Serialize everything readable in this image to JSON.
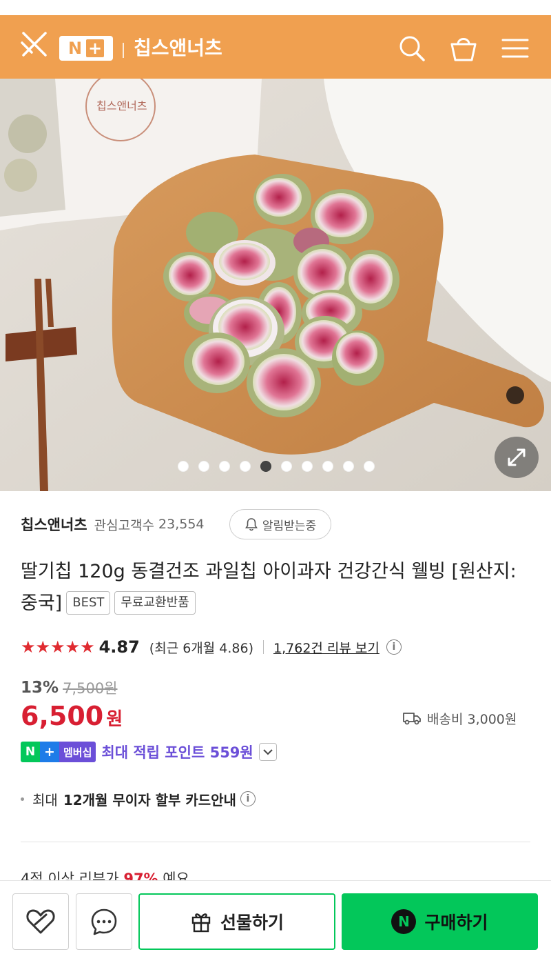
{
  "header": {
    "brand_badge_n": "N",
    "brand_badge_plus": "+",
    "store_name": "칩스앤너츠",
    "icons": [
      "close-icon",
      "search-icon",
      "bag-icon",
      "menu-icon"
    ]
  },
  "hero": {
    "image_count": 10,
    "active_index": 4,
    "expand_icon": "expand-icon",
    "bag_label": "칩스앤너츠"
  },
  "store": {
    "name": "칩스앤너츠",
    "follow_label": "관심고객수",
    "follow_count": "23,554",
    "alarm_label": "알림받는중"
  },
  "product": {
    "title": "딸기칩 120g 동결건조 과일칩 아이과자 건강간식 웰빙 [원산지:중국]",
    "badges": [
      "BEST",
      "무료교환반품"
    ]
  },
  "rating": {
    "stars": "★★★★★",
    "score": "4.87",
    "recent": "(최근 6개월 4.86)",
    "review_link": "1,762건 리뷰 보기",
    "info": "i"
  },
  "price": {
    "discount": "13%",
    "original": "7,500원",
    "sale": "6,500",
    "unit": "원",
    "shipping": "배송비 3,000원"
  },
  "membership": {
    "n": "N",
    "plus": "+",
    "label": "멤버십",
    "text": "최대 적립 포인트 559원"
  },
  "card": {
    "pre": "최대",
    "bold": "12개월 무이자 할부 카드안내"
  },
  "review_peek": {
    "pre": "4점 이상 리뷰가",
    "pct": "97%",
    "post": "예요"
  },
  "bottom": {
    "gift_label": "선물하기",
    "buy_n": "N",
    "buy_label": "구매하기"
  },
  "colors": {
    "header": "#f0a050",
    "price": "#d81f32",
    "naver_green": "#03c75a",
    "member_purple": "#6b4fd8"
  }
}
